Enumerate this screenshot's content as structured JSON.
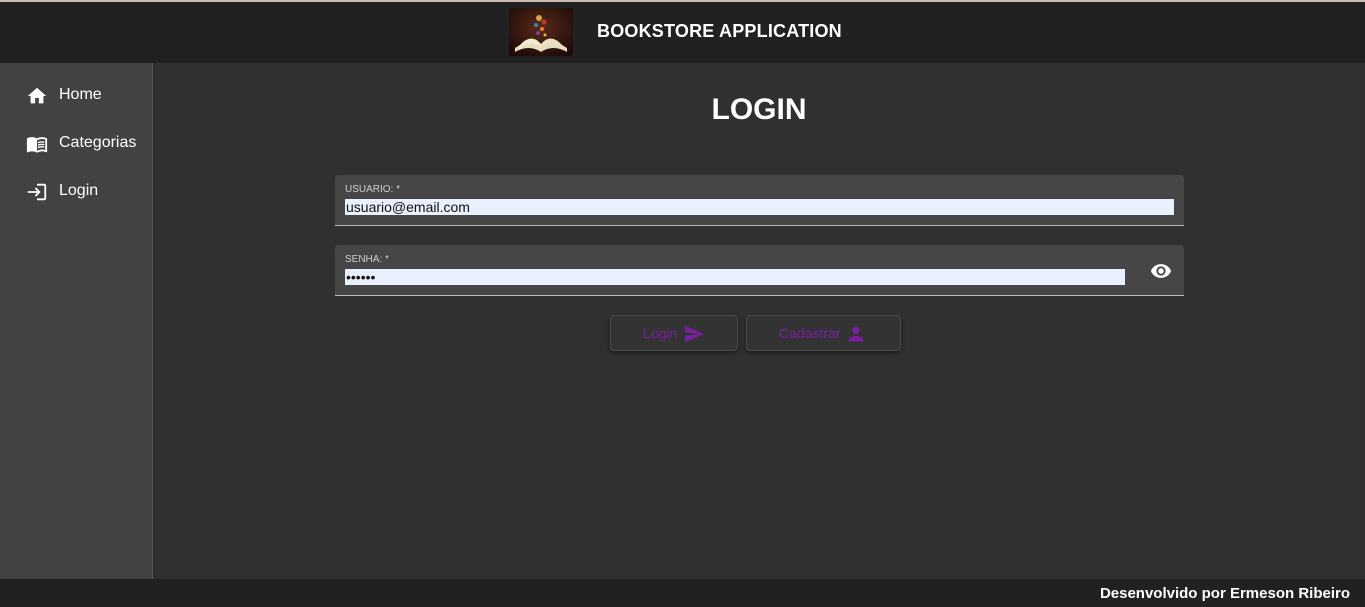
{
  "header": {
    "app_title": "BOOKSTORE APPLICATION",
    "logo_icon": "open-book-logo"
  },
  "sidebar": {
    "items": [
      {
        "label": "Home",
        "icon": "home-icon"
      },
      {
        "label": "Categorias",
        "icon": "book-icon"
      },
      {
        "label": "Login",
        "icon": "login-icon"
      }
    ]
  },
  "main": {
    "title": "LOGIN",
    "username": {
      "label": "USUARIO: *",
      "value": "usuario@email.com"
    },
    "password": {
      "label": "SENHA: *",
      "value": "••••••",
      "toggle_icon": "eye-icon"
    },
    "buttons": {
      "login_label": "Login",
      "login_icon": "send-icon",
      "register_label": "Cadastrar",
      "register_icon": "person-icon"
    }
  },
  "footer": {
    "text": "Desenvolvido por Ermeson Ribeiro"
  },
  "colors": {
    "toolbar": "#212121",
    "sidebar": "#424242",
    "content": "#303030",
    "field": "#464646",
    "accent": "#7b1fa2",
    "autofill": "#e8f0fe"
  }
}
